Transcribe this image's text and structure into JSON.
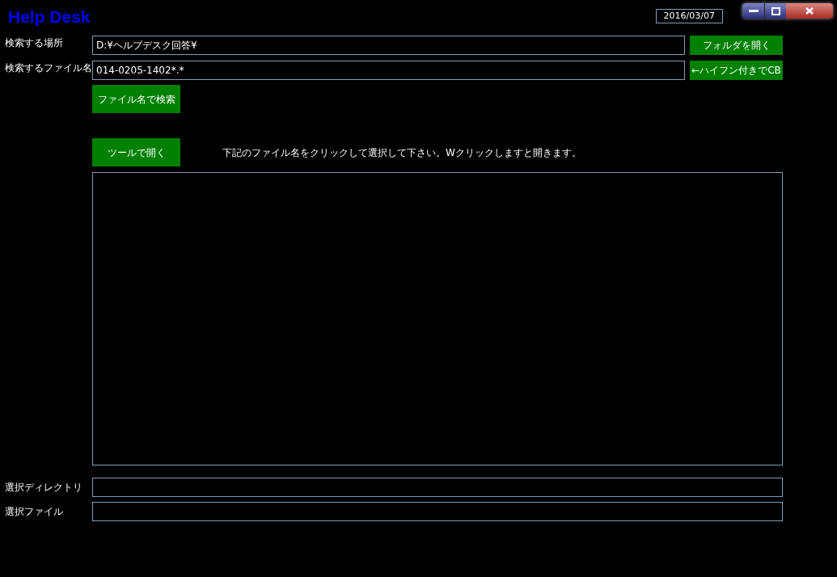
{
  "window": {
    "title": "Help Desk",
    "date": "2016/03/07"
  },
  "search_fields": [
    {
      "label": "検索する場所",
      "value": "D:¥ヘルプデスク回答¥",
      "button": "フォルダを開く"
    },
    {
      "label": "検索するファイル名",
      "value": "014-0205-1402*.*",
      "button": "←ハイフン付きでCB"
    }
  ],
  "search_button": "ファイル名で検索",
  "open_tool_button": "ツールで開く",
  "instruction": "下記のファイル名をクリックして選択して下さい。Wクリックしますと開きます。",
  "selection_fields": [
    {
      "label": "選択ディレクトリ"
    },
    {
      "label": "選択ファイル"
    }
  ]
}
